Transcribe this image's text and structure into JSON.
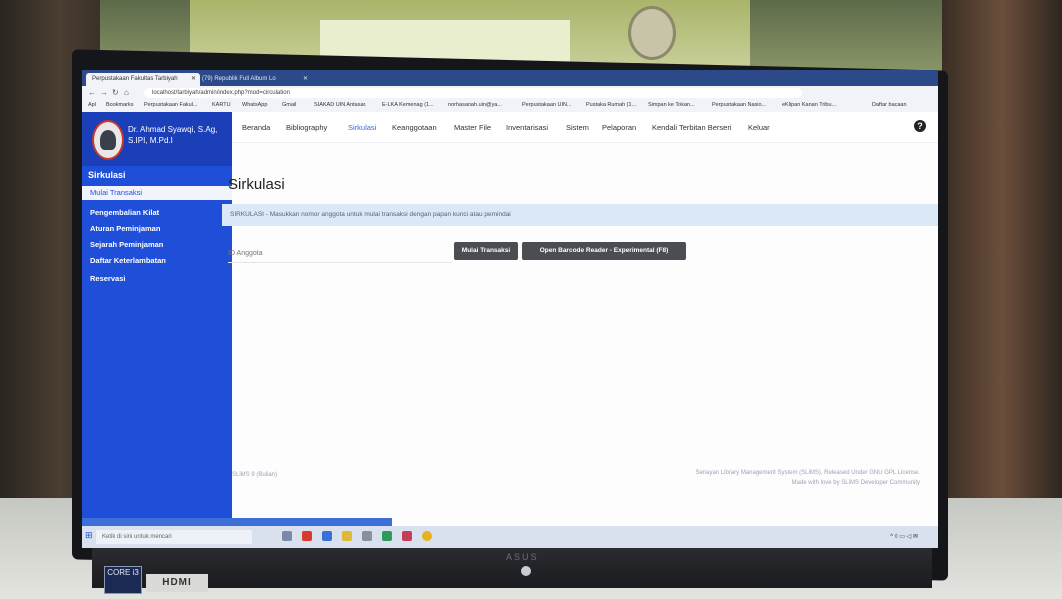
{
  "browser": {
    "tabs": [
      "Perpustakaan Fakultas Tarbiyah",
      "(79) Republik Full Album Lo"
    ],
    "url": "localhost/tarbiyah/admin/index.php?mod=circulation",
    "bookmarks": [
      "Apl",
      "Bookmarks",
      "Perpustakaan Fakul...",
      "KARTU",
      "WhatsApp",
      "Gmail",
      "SIAKAD UIN Antasar.",
      "E-LKA Kemenag (1...",
      "norhasanah.uin@ya...",
      "Perpustakaan UIN...",
      "Pustaka Rumah (1...",
      "Simpan ke Tokan...",
      "Perpustakaan Nasio...",
      "eKlipan Kanan Tribu...",
      "Daftar bacaan"
    ]
  },
  "sidebar": {
    "profile_name": "Dr. Ahmad Syawqi, S.Ag, S.IPI, M.Pd.I",
    "heading": "Sirkulasi",
    "items": [
      "Mulai Transaksi",
      "Pengembalian Kilat",
      "Aturan Peminjaman",
      "Sejarah Peminjaman",
      "Daftar Keterlambatan",
      "Reservasi"
    ]
  },
  "topnav": [
    "Beranda",
    "Bibliography",
    "Sirkulasi",
    "Keanggotaan",
    "Master File",
    "Inventarisasi",
    "Sistem",
    "Pelaporan",
    "Kendali Terbitan Berseri",
    "Keluar"
  ],
  "main": {
    "title": "Sirkulasi",
    "info": "SIRKULASI - Masukkan nomor anggota untuk mulai transaksi dengan papan kunci atau pemindai",
    "id_label": "ID Anggota",
    "btn_start": "Mulai Transaksi",
    "btn_barcode": "Open Barcode Reader - Experimental (F8)"
  },
  "footer": {
    "version": "SLiMS 9 (Bulian)",
    "line1": "Senayan Library Management System (SLiMS). Released Under GNU GPL License.",
    "line2": "Made with love by SLiMS Developer Community"
  },
  "taskbar": {
    "search": "Ketik di sini untuk mencari"
  },
  "hardware": {
    "monitor_brand": "ASUS",
    "sticker": "CORE i3",
    "port": "HDMI"
  }
}
